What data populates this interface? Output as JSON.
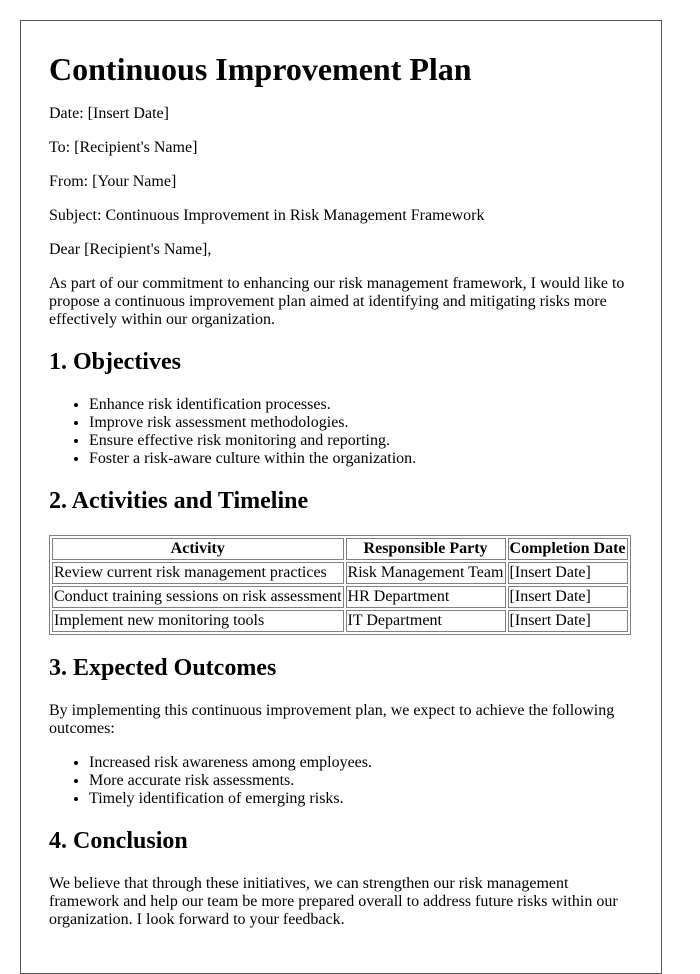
{
  "document": {
    "title": "Continuous Improvement Plan",
    "header_fields": [
      {
        "label": "Date:",
        "value": "[Insert Date]"
      },
      {
        "label": "To:",
        "value": "[Recipient's Name]"
      },
      {
        "label": "From:",
        "value": "[Your Name]"
      },
      {
        "label": "Subject:",
        "value": "Continuous Improvement in Risk Management Framework"
      }
    ],
    "salutation": "Dear [Recipient's Name],",
    "intro": "As part of our commitment to enhancing our risk management framework, I would like to propose a continuous improvement plan aimed at identifying and mitigating risks more effectively within our organization.",
    "sections": {
      "objectives": {
        "heading": "1. Objectives",
        "items": [
          "Enhance risk identification processes.",
          "Improve risk assessment methodologies.",
          "Ensure effective risk monitoring and reporting.",
          "Foster a risk-aware culture within the organization."
        ]
      },
      "activities": {
        "heading": "2. Activities and Timeline",
        "columns": [
          "Activity",
          "Responsible Party",
          "Completion Date"
        ],
        "rows": [
          [
            "Review current risk management practices",
            "Risk Management Team",
            "[Insert Date]"
          ],
          [
            "Conduct training sessions on risk assessment",
            "HR Department",
            "[Insert Date]"
          ],
          [
            "Implement new monitoring tools",
            "IT Department",
            "[Insert Date]"
          ]
        ]
      },
      "outcomes": {
        "heading": "3. Expected Outcomes",
        "intro": "By implementing this continuous improvement plan, we expect to achieve the following outcomes:",
        "items": [
          "Increased risk awareness among employees.",
          "More accurate risk assessments.",
          "Timely identification of emerging risks."
        ]
      },
      "conclusion": {
        "heading": "4. Conclusion",
        "text": "We believe that through these initiatives, we can strengthen our risk management framework and help our team be more prepared overall to address future risks within our organization. I look forward to your feedback."
      }
    }
  }
}
